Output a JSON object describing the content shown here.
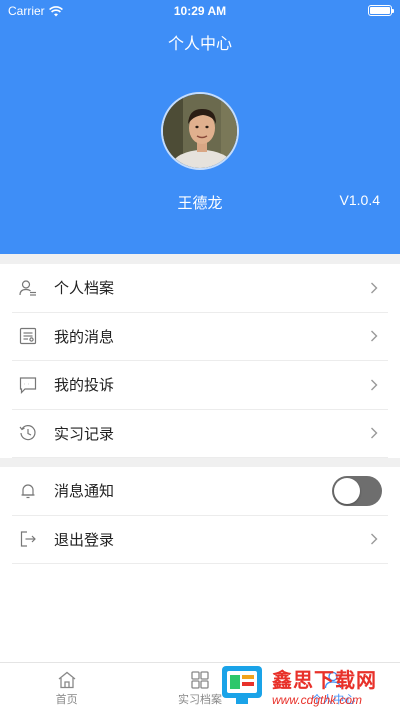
{
  "status_bar": {
    "carrier": "Carrier",
    "time": "10:29 AM"
  },
  "header": {
    "title": "个人中心",
    "username": "王德龙",
    "version": "V1.0.4"
  },
  "menu_group_1": [
    {
      "label": "个人档案",
      "icon": "user-profile-icon"
    },
    {
      "label": "我的消息",
      "icon": "message-doc-icon"
    },
    {
      "label": "我的投诉",
      "icon": "chat-bubble-icon"
    },
    {
      "label": "实习记录",
      "icon": "history-icon"
    }
  ],
  "menu_group_2": {
    "notify_label": "消息通知",
    "notify_enabled": false,
    "logout_label": "退出登录"
  },
  "tabbar": {
    "tabs": [
      {
        "label": "首页",
        "icon": "home-icon"
      },
      {
        "label": "实习档案",
        "icon": "grid-icon"
      },
      {
        "label": "个人中心",
        "icon": "person-icon"
      }
    ]
  },
  "watermark": {
    "main": "鑫思下载网",
    "sub": "www.cdgthk.com"
  },
  "colors": {
    "primary": "#3e8ef7",
    "toggle_off": "#6e6e6e",
    "watermark": "#e8312a"
  }
}
